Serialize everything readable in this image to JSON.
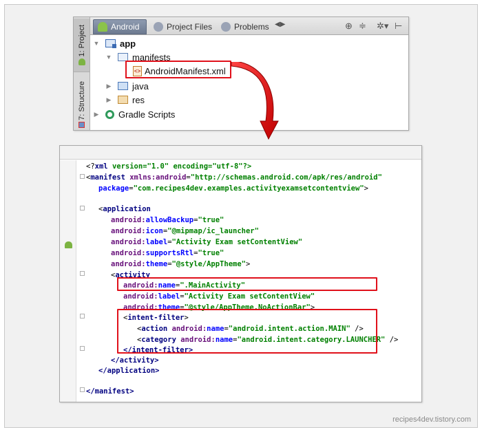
{
  "project_panel": {
    "side_tabs": {
      "project": "1: Project",
      "structure": "7: Structure"
    },
    "tabs": [
      {
        "label": "Android"
      },
      {
        "label": "Project Files"
      },
      {
        "label": "Problems"
      }
    ],
    "toolbar": {
      "nav": "◀▶",
      "sync": "⊕",
      "collapse": "≑",
      "settings": "✲▾",
      "hide": "⊢"
    },
    "tree": {
      "app": "app",
      "manifests": "manifests",
      "manifest_file": "AndroidManifest.xml",
      "java": "java",
      "res": "res",
      "gradle": "Gradle Scripts"
    }
  },
  "editor": {
    "lines": {
      "l1_open": "<?",
      "l1_tag": "xml",
      "l1_rest": " version=\"1.0\" encoding=\"utf-8\"?>",
      "l2_tag": "manifest",
      "l2_ns_attr": "xmlns:android",
      "l2_val": "\"http://schemas.android.com/apk/res/android\"",
      "l3_attr": "package",
      "l3_val": "\"com.recipes4dev.examples.activityexamsetcontentview\"",
      "l5_tag": "application",
      "allowBackup_attr": "allowBackup",
      "allowBackup_val": "\"true\"",
      "icon_attr": "icon",
      "icon_val": "\"@mipmap/ic_launcher\"",
      "label_attr": "label",
      "app_label_val": "\"Activity Exam setContentView\"",
      "supportsRtl_attr": "supportsRtl",
      "supportsRtl_val": "\"true\"",
      "theme_attr": "theme",
      "app_theme_val": "\"@style/AppTheme\"",
      "activity_tag": "activity",
      "name_attr": "name",
      "activity_name_val": "\".MainActivity\"",
      "activity_label_val": "\"Activity Exam setContentView\"",
      "activity_theme_val": "\"@style/AppTheme.NoActionBar\"",
      "intent_filter_tag": "intent-filter",
      "action_tag": "action",
      "action_val": "\"android.intent.action.MAIN\"",
      "category_tag": "category",
      "category_val": "\"android.intent.category.LAUNCHER\"",
      "android_prefix": "android:",
      "close_intent_filter": "</intent-filter>",
      "close_activity": "</activity>",
      "close_application": "</application>",
      "close_manifest": "</manifest>"
    }
  },
  "watermark": "recipes4dev.tistory.com",
  "colors": {
    "highlight": "#e0101a",
    "xml_tag": "#000080",
    "xml_attr": "#0000ff",
    "xml_value": "#008000",
    "xml_ns": "#660e7a"
  }
}
